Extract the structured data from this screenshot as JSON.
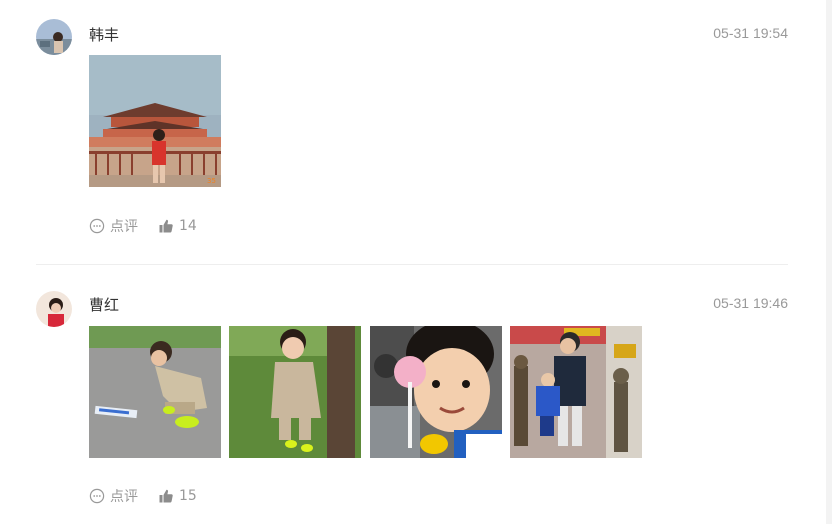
{
  "posts": [
    {
      "author": "韩丰",
      "time": "05-31 19:54",
      "comment_label": "点评",
      "like_count": "14"
    },
    {
      "author": "曹红",
      "time": "05-31 19:46",
      "comment_label": "点评",
      "like_count": "15"
    }
  ],
  "colors": {
    "text_primary": "#333333",
    "text_secondary": "#999999",
    "divider": "#eeeeee"
  },
  "icons": {
    "comment": "comment-bubble-icon",
    "like": "thumbs-up-icon"
  }
}
